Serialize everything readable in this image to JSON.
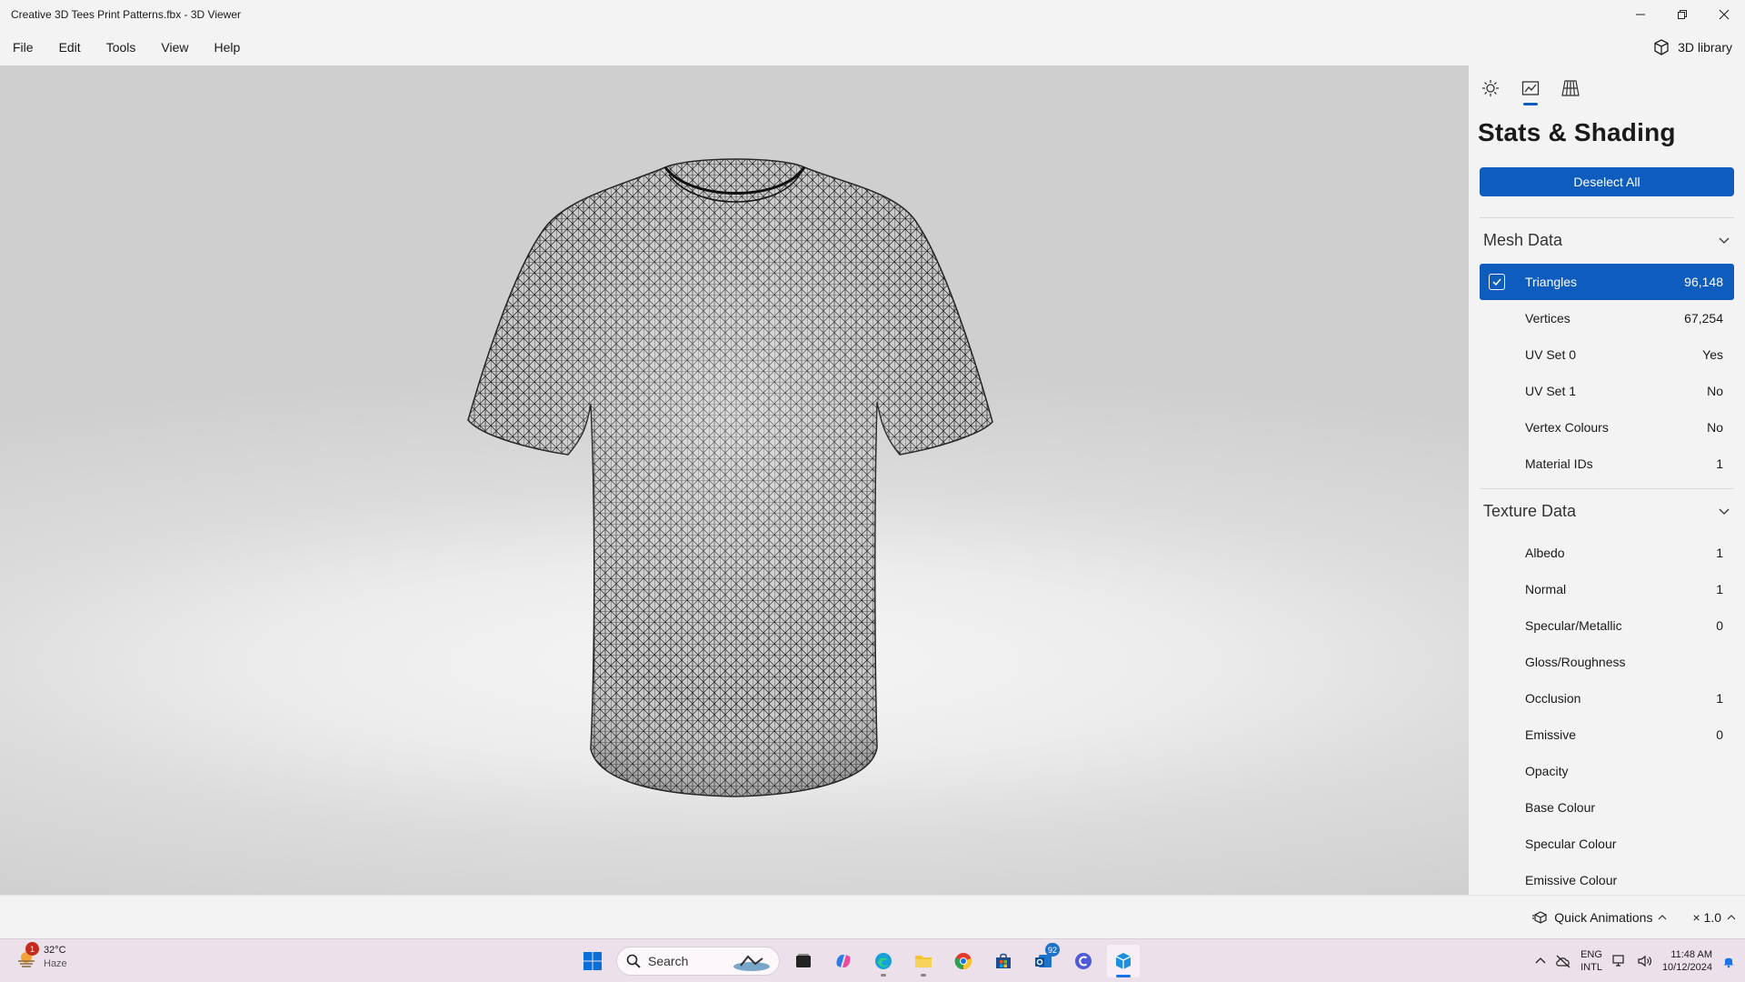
{
  "window": {
    "title": "Creative 3D Tees Print Patterns.fbx - 3D Viewer",
    "controls": [
      "minimize-icon",
      "restore-icon",
      "close-icon"
    ]
  },
  "menu": {
    "items": [
      "File",
      "Edit",
      "Tools",
      "View",
      "Help"
    ],
    "library_label": "3D library"
  },
  "panel": {
    "tabs": [
      "lighting-icon",
      "stats-icon",
      "grid-icon"
    ],
    "title": "Stats & Shading",
    "deselect_label": "Deselect All",
    "mesh": {
      "label": "Mesh Data",
      "rows": [
        {
          "label": "Triangles",
          "value": "96,148",
          "selected": true
        },
        {
          "label": "Vertices",
          "value": "67,254"
        },
        {
          "label": "UV Set 0",
          "value": "Yes"
        },
        {
          "label": "UV Set 1",
          "value": "No"
        },
        {
          "label": "Vertex Colours",
          "value": "No"
        },
        {
          "label": "Material IDs",
          "value": "1"
        }
      ]
    },
    "texture": {
      "label": "Texture Data",
      "rows": [
        {
          "label": "Albedo",
          "value": "1"
        },
        {
          "label": "Normal",
          "value": "1"
        },
        {
          "label": "Specular/Metallic",
          "value": "0"
        },
        {
          "label": "Gloss/Roughness",
          "value": ""
        },
        {
          "label": "Occlusion",
          "value": "1"
        },
        {
          "label": "Emissive",
          "value": "0"
        },
        {
          "label": "Opacity",
          "value": ""
        },
        {
          "label": "Base Colour",
          "value": ""
        },
        {
          "label": "Specular Colour",
          "value": ""
        },
        {
          "label": "Emissive Colour",
          "value": ""
        }
      ]
    }
  },
  "animation": {
    "label": "Quick Animations",
    "speed": "× 1.0"
  },
  "taskbar": {
    "weather": {
      "temp": "32°C",
      "condition": "Haze",
      "badge": "1"
    },
    "search_placeholder": "Search",
    "mail_badge": "92",
    "tray": {
      "lang": "ENG",
      "layout": "INTL",
      "time": "11:48 AM",
      "date": "10/12/2024"
    }
  },
  "colors": {
    "accent": "#0f5cbf",
    "taskbar": "#ece1ea"
  }
}
